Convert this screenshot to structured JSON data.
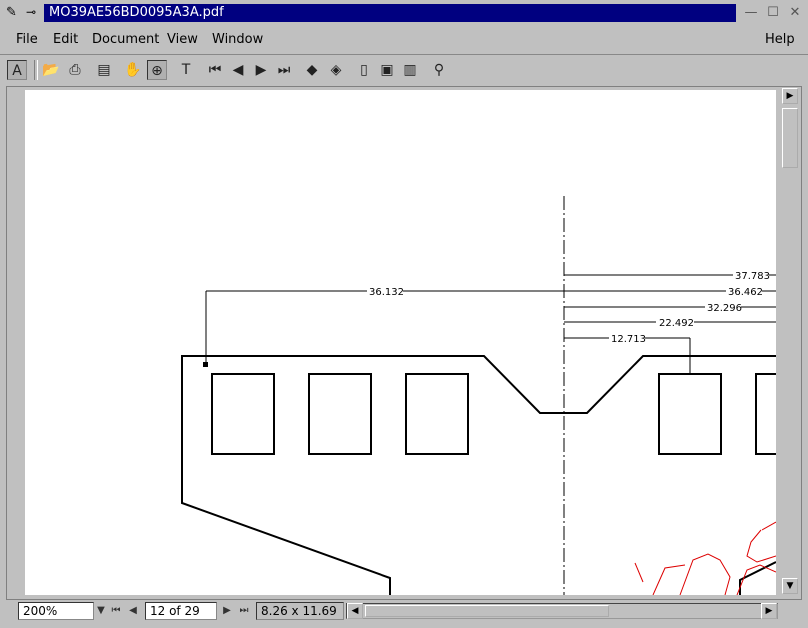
{
  "window": {
    "title": "MO39AE56BD0095A3A.pdf"
  },
  "menu": {
    "file": "File",
    "edit": "Edit",
    "document": "Document",
    "view": "View",
    "window": "Window",
    "help": "Help"
  },
  "drawing": {
    "dims": [
      "37.783",
      "36.462",
      "32.296",
      "22.492",
      "12.713",
      "36.132"
    ]
  },
  "status": {
    "zoom": "200%",
    "page": "12 of 29",
    "size": "8.26 x 11.69"
  },
  "icons": {
    "app": "acrobat-icon",
    "pin": "pin-icon",
    "minimize": "minimize-icon",
    "maximize": "maximize-icon",
    "close": "close-icon"
  }
}
